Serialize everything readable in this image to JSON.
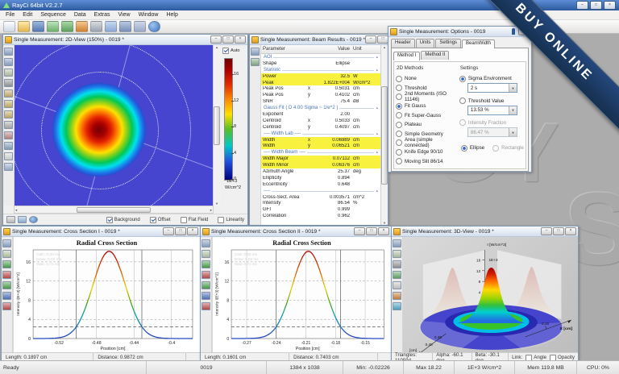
{
  "app": {
    "title": "RayCi 64bit V2.2.7",
    "menu": [
      "File",
      "Edit",
      "Sequence",
      "Data",
      "Extras",
      "View",
      "Window",
      "Help"
    ],
    "toolbar_icons": [
      "new-report-icon",
      "open-icon",
      "save-icon",
      "undo-icon",
      "redo-icon",
      "beam-adjust-icon",
      "camera-setup-icon",
      "export-icon",
      "screen-icon",
      "windows-icon",
      "help-globe-icon"
    ]
  },
  "banner": {
    "text": "BUY ONLINE",
    "color": "#1c3a66"
  },
  "watermark": {
    "part1": "GY",
    "part2": "S"
  },
  "view2d": {
    "title": "Single Measurement: 2D-View (150%) - 0019 *",
    "tools": [
      {
        "name": "save-icon",
        "c": "#8fa7c9"
      },
      {
        "name": "save-as-icon",
        "c": "#8fa7c9"
      },
      {
        "name": "copy-icon",
        "c": "#b7c6a8"
      },
      {
        "name": "settings-gear-icon",
        "c": "#9a9a9a"
      },
      {
        "name": "zoom-in-icon",
        "c": "#c9b06a"
      },
      {
        "name": "zoom-out-icon",
        "c": "#c9b06a"
      },
      {
        "name": "zoom-reset-icon",
        "c": "#c9b06a"
      },
      {
        "name": "print-icon",
        "c": "#b0b0b0"
      },
      {
        "name": "palette-icon",
        "c": "#c08888"
      },
      {
        "name": "ruler-icon",
        "c": "#88a8c0"
      },
      {
        "name": "selection-icon",
        "c": "#d8d8d8"
      },
      {
        "name": "info-icon",
        "c": "#9fb4d0"
      }
    ],
    "corner_icons": [
      "display-icon",
      "image-icon",
      "camera-icon"
    ],
    "auto_label": "Auto",
    "auto_checked": true,
    "scale_ticks": [
      16,
      12,
      8,
      4,
      0
    ],
    "scale_max": 18.5,
    "scale_exp": "1E+3",
    "scale_unit": "W/cm^2",
    "correction_checkboxes": [
      {
        "label": "Background",
        "checked": true
      },
      {
        "label": "Offset",
        "checked": true
      },
      {
        "label": "Flat Field",
        "checked": false
      },
      {
        "label": "Linearity",
        "checked": false
      }
    ]
  },
  "results": {
    "title": "Single Measurement: Beam Results - 0019 *",
    "tools": [
      {
        "name": "save-icon",
        "c": "#8fa7c9"
      },
      {
        "name": "watch-icon",
        "c": "#88b088"
      }
    ],
    "columns": [
      "Parameter",
      "Value",
      "Unit"
    ],
    "rows": [
      {
        "s": "AOI"
      },
      {
        "n": "Shape",
        "a": "",
        "v": "Ellipse",
        "u": ""
      },
      {
        "s": "Statistic"
      },
      {
        "n": "Power",
        "a": "",
        "v": "32.5",
        "u": "W",
        "hl": true
      },
      {
        "n": "Peak",
        "a": "",
        "v": "1.822E+004",
        "u": "W/cm^2",
        "hl": true
      },
      {
        "n": "Peak Pos",
        "a": "x",
        "v": "0.5031",
        "u": "cm"
      },
      {
        "n": "Peak Pos",
        "a": "y",
        "v": "0.4102",
        "u": "cm"
      },
      {
        "n": "SNR",
        "a": "",
        "v": "75.4",
        "u": "dB"
      },
      {
        "s": "Gauss Fit ( D 4.00 Sigma ~ 1/e^2 )"
      },
      {
        "n": "Exponent",
        "a": "",
        "v": "2.00",
        "u": ""
      },
      {
        "n": "Centroid",
        "a": "x",
        "v": "0.5033",
        "u": "cm"
      },
      {
        "n": "Centroid",
        "a": "y",
        "v": "0.4097",
        "u": "cm"
      },
      {
        "s": "---- Width Lab ----"
      },
      {
        "n": "Width",
        "a": "x",
        "v": "0.06989",
        "u": "cm",
        "hl": true
      },
      {
        "n": "Width",
        "a": "y",
        "v": "0.06521",
        "u": "cm",
        "hl": true
      },
      {
        "s": "---- Width Beam ----"
      },
      {
        "n": "Width Major",
        "a": "",
        "v": "0.07112",
        "u": "cm",
        "hl": true
      },
      {
        "n": "Width Minor",
        "a": "",
        "v": "0.06376",
        "u": "cm",
        "hl": true
      },
      {
        "n": "Azimuth Angle",
        "a": "",
        "v": "25.37",
        "u": "deg"
      },
      {
        "n": "Ellipticity",
        "a": "",
        "v": "0.894",
        "u": ""
      },
      {
        "n": "Eccentricity",
        "a": "",
        "v": "0.648",
        "u": ""
      },
      {
        "s": "----"
      },
      {
        "n": "Cross-Sect. Area",
        "a": "",
        "v": "0.003571",
        "u": "cm^2"
      },
      {
        "n": "Intensity",
        "a": "",
        "v": "86.54",
        "u": "%"
      },
      {
        "n": "GFI",
        "a": "",
        "v": "0.999",
        "u": ""
      },
      {
        "n": "Correlation",
        "a": "",
        "v": "0.962",
        "u": ""
      }
    ]
  },
  "options": {
    "title": "Single Measurement: Options - 0019",
    "tabs": [
      "Header",
      "Units",
      "Settings",
      "BeamWidth"
    ],
    "active_tab": "BeamWidth",
    "subtabs": [
      "Method I",
      "Method II"
    ],
    "active_subtab": "Method I",
    "methods_label": "2D Methods",
    "methods": [
      {
        "label": "None",
        "selected": false
      },
      {
        "label": "Threshold",
        "selected": false
      },
      {
        "label": "2nd Moments (ISO 11146)",
        "selected": false
      },
      {
        "label": "Fit Gauss",
        "selected": true
      },
      {
        "label": "Fit Super-Gauss",
        "selected": false
      },
      {
        "label": "Plateau",
        "selected": false
      },
      {
        "label": "Simple Geometry",
        "selected": false
      },
      {
        "label": "Area (simple connected)",
        "selected": false
      },
      {
        "label": "Knife Edge 90/10",
        "selected": false
      },
      {
        "label": "Moving Slit 86/14",
        "selected": false
      }
    ],
    "settings_label": "Settings",
    "settings": [
      {
        "label": "Sigma Environment",
        "selected": true,
        "disabled": false,
        "value": "2 s"
      },
      {
        "label": "Threshold Value",
        "selected": false,
        "disabled": false,
        "value": "13.53 %"
      },
      {
        "label": "Intensity Fraction",
        "selected": false,
        "disabled": true,
        "value": "86.47 %"
      }
    ],
    "shape_options": [
      {
        "label": "Ellipse",
        "selected": true,
        "disabled": false
      },
      {
        "label": "Rectangle",
        "selected": false,
        "disabled": true
      }
    ]
  },
  "cross1": {
    "title": "Single Measurement: Cross Section I - 0019 *",
    "tools": [
      {
        "name": "save-icon",
        "c": "#8fa7c9"
      },
      {
        "name": "copy-icon",
        "c": "#b7c6a8"
      },
      {
        "name": "grid-green-icon",
        "c": "#4ea34e"
      },
      {
        "name": "grid-red-icon",
        "c": "#c05050"
      },
      {
        "name": "grid-multi-icon",
        "c": "#4ea34e"
      },
      {
        "name": "grid-blue-icon",
        "c": "#5878c0"
      },
      {
        "name": "marker-red-icon",
        "c": "#c05050"
      }
    ],
    "status": {
      "length": "Length: 0.1897 cm",
      "distance": "Distance: 0.9872 cm"
    }
  },
  "cross2": {
    "title": "Single Measurement: Cross Section II - 0019 *",
    "tools": [
      {
        "name": "save-icon",
        "c": "#8fa7c9"
      },
      {
        "name": "copy-icon",
        "c": "#b7c6a8"
      },
      {
        "name": "grid-green-icon",
        "c": "#4ea34e"
      },
      {
        "name": "grid-red-icon",
        "c": "#c05050"
      },
      {
        "name": "grid-multi-icon",
        "c": "#4ea34e"
      },
      {
        "name": "grid-blue-icon",
        "c": "#5878c0"
      },
      {
        "name": "marker-red-icon",
        "c": "#c05050"
      }
    ],
    "status": {
      "length": "Length: 0.1601 cm",
      "distance": "Distance: 0.7403 cm"
    }
  },
  "view3d": {
    "title": "Single Measurement: 3D-View - 0019 *",
    "tools": [
      {
        "name": "save-icon",
        "c": "#8fa7c9"
      },
      {
        "name": "copy-icon",
        "c": "#b7c6a8"
      },
      {
        "name": "texture-icon",
        "c": "#9a9a9a"
      },
      {
        "name": "render-icon",
        "c": "#66aa66"
      },
      {
        "name": "wall-icon",
        "c": "#cccccc"
      },
      {
        "name": "palette-icon",
        "c": "#cc8844"
      },
      {
        "name": "grid3d-icon",
        "c": "#55aacc"
      }
    ],
    "z_label": "I [W/cm^2]",
    "z_exp": "1E+3",
    "z_ticks": [
      "16",
      "12",
      "8",
      "4"
    ],
    "x_label": "X [cm]",
    "x_tick": "0.15",
    "y_label": "[cm]",
    "y_tick1": "0.45",
    "y_tick2": "0.48",
    "status": {
      "triangles": "Triangles: 110594",
      "alpha": "Alpha: -60.1 deg",
      "beta": "Beta: -30.1 deg",
      "link": "Link:",
      "checkboxes": [
        {
          "label": "Angle",
          "checked": false
        },
        {
          "label": "Opacity",
          "checked": false
        }
      ]
    }
  },
  "statusbar": {
    "ready": "Ready",
    "id": "0019",
    "resolution": "1384 x 1038",
    "min": "Min: -0.02226",
    "max": "Max 18.22",
    "unit": "1E+3 W/cm^2",
    "mem": "Mem 119.8 MB",
    "cpu": "CPU: 0%"
  },
  "chart_data": [
    {
      "type": "line",
      "window": "cross1",
      "title": "Radial Cross Section",
      "xlabel": "Position [cm]",
      "ylabel": "Intensity I(E+3) [W/cm^2]",
      "x_ticks": [
        "-0.52",
        "-0.48",
        "-0.44",
        "-0.4"
      ],
      "y_ticks": [
        0,
        4,
        8,
        12,
        16
      ],
      "xlim": [
        -0.5475,
        -0.3775
      ],
      "ylim": [
        0,
        18.5
      ],
      "gaussian": {
        "center": -0.4665,
        "peak": 18.2,
        "width": 0.0699
      },
      "threshold": 2.46,
      "markers": [
        -0.5015,
        -0.4316
      ],
      "overlay": [
        "Calc: 0.00 ms",
        "Draw: 0.02 ms",
        "Wait: 0.71 ms"
      ],
      "grid": true,
      "legend": false
    },
    {
      "type": "line",
      "window": "cross2",
      "title": "Radial Cross Section",
      "xlabel": "Position [cm]",
      "ylabel": "Intensity I(E+3) [W/cm^2]",
      "x_ticks": [
        "-0.27",
        "-0.24",
        "-0.21",
        "-0.18",
        "-0.15"
      ],
      "y_ticks": [
        0,
        4,
        8,
        12,
        16
      ],
      "xlim": [
        -0.2855,
        -0.131
      ],
      "ylim": [
        0,
        18.5
      ],
      "gaussian": {
        "center": -0.2075,
        "peak": 18.2,
        "width": 0.0652
      },
      "threshold": 2.46,
      "markers": [
        -0.2401,
        -0.1749
      ],
      "overlay": [
        "Calc: 0.00 ms",
        "Draw: 0.02 ms",
        "Wait: 0.71 ms"
      ],
      "grid": true,
      "legend": false
    }
  ]
}
